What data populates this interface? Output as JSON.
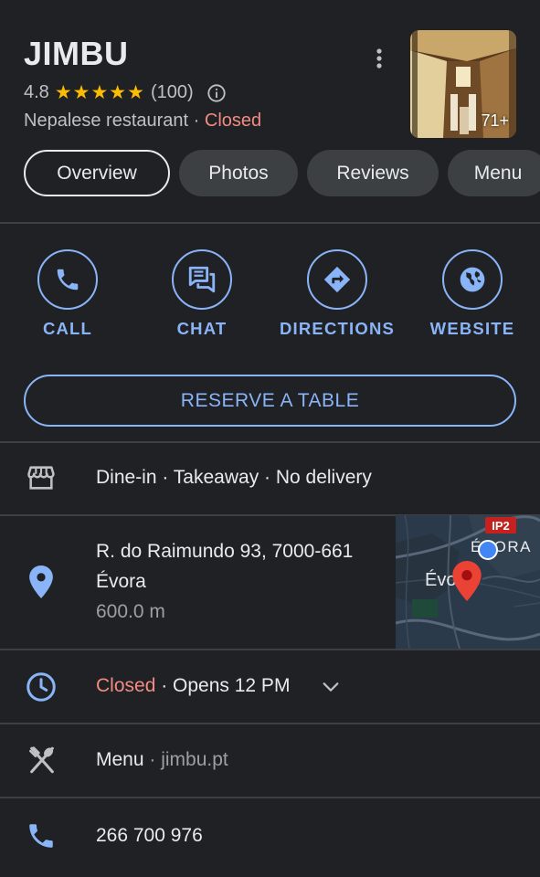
{
  "place": {
    "name": "JIMBU",
    "rating": "4.8",
    "stars": "★★★★★",
    "review_count": "(100)",
    "category": "Nepalese restaurant",
    "separator": " · ",
    "status": "Closed",
    "photo_count": "71+"
  },
  "tabs": [
    {
      "label": "Overview"
    },
    {
      "label": "Photos"
    },
    {
      "label": "Reviews"
    },
    {
      "label": "Menu"
    }
  ],
  "actions": [
    {
      "label": "CALL",
      "icon": "phone-icon"
    },
    {
      "label": "CHAT",
      "icon": "chat-icon"
    },
    {
      "label": "DIRECTIONS",
      "icon": "directions-icon"
    },
    {
      "label": "WEBSITE",
      "icon": "globe-icon"
    }
  ],
  "reserve_label": "RESERVE A TABLE",
  "service": {
    "text": "Dine-in · Takeaway · No delivery",
    "icon": "storefront-icon"
  },
  "address": {
    "line1": "R. do Raimundo 93, 7000-661",
    "line2": "Évora",
    "distance": "600.0 m",
    "icon": "location-pin-icon"
  },
  "map": {
    "road_label": "IP2",
    "city_label_top": "ÉVORA",
    "city_label": "Évora"
  },
  "hours": {
    "status": "Closed",
    "opens": " · Opens 12 PM",
    "icon": "clock-icon"
  },
  "menu_row": {
    "label": "Menu",
    "link": " · jimbu.pt",
    "icon": "utensils-icon"
  },
  "phone": {
    "number": "266 700 976",
    "icon": "phone-icon"
  },
  "colors": {
    "background": "#202124",
    "accent": "#8ab4f8",
    "closed": "#f28b82",
    "star": "#fbbc04",
    "pin": "#ea4335"
  }
}
